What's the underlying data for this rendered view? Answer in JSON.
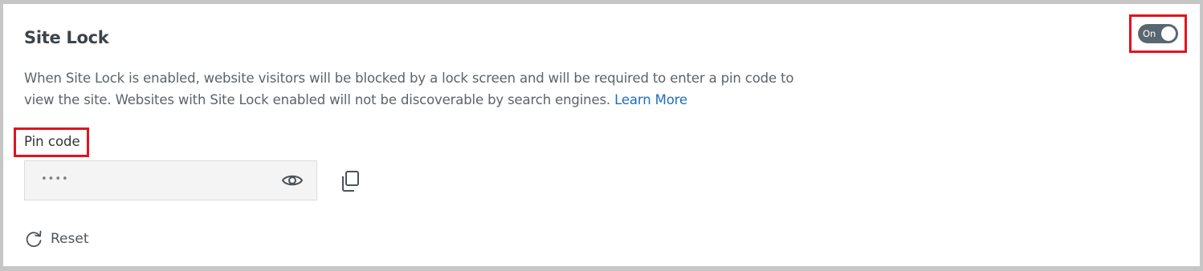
{
  "section": {
    "title": "Site Lock",
    "toggle": {
      "label": "On",
      "state": "on"
    },
    "description": "When Site Lock is enabled, website visitors will be blocked by a lock screen and will be required to enter a pin code to view the site. Websites with Site Lock enabled will not be discoverable by search engines.",
    "learn_more": "Learn More"
  },
  "pin": {
    "label": "Pin code",
    "value": "••••"
  },
  "reset": {
    "label": "Reset"
  },
  "icons": {
    "eye": "eye-icon",
    "copy": "copy-icon",
    "reset": "refresh-icon"
  },
  "colors": {
    "toggle_on": "#5b6770",
    "link": "#1e6fbe",
    "highlight": "#e0141e"
  }
}
